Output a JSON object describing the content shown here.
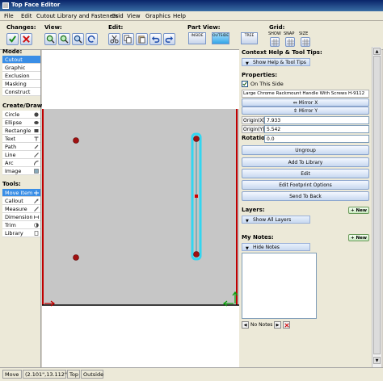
{
  "window": {
    "title": "Top Face Editor"
  },
  "menu": [
    "File",
    "Edit",
    "Cutout Library and Fasteners",
    "Grid",
    "View",
    "Graphics",
    "Help"
  ],
  "toolbar": {
    "changes_label": "Changes:",
    "view_label": "View:",
    "edit_label": "Edit:",
    "partview_label": "Part View:",
    "inside_label": "INSIDE",
    "outside_label": "OUTSIDE",
    "tree_label": "TREE",
    "grid_label": "Grid:",
    "show_label": "SHOW",
    "snap_label": "SNAP",
    "size_label": "SIZE"
  },
  "left": {
    "mode_head": "Mode:",
    "modes": [
      "Cutout",
      "Graphic",
      "Exclusion",
      "Masking",
      "Construct"
    ],
    "create_head": "Create/Draw:",
    "create": [
      "Circle",
      "Ellipse",
      "Rectangle",
      "Text",
      "Path",
      "Line",
      "Arc",
      "Image"
    ],
    "tools_head": "Tools:",
    "tools": [
      "Move Item",
      "Callout",
      "Measure",
      "Dimension",
      "Trim",
      "Library"
    ]
  },
  "right": {
    "help_head": "Context Help & Tool Tips:",
    "help_dd": "Show Help & Tool Tips",
    "props_head": "Properties:",
    "on_this_side": "On This Side",
    "part_name": "Large Chrome Rackmount Handle With Screws H-9112",
    "mirror_x": "Mirror X",
    "mirror_y": "Mirror Y",
    "origin_x_label": "Origin(X)",
    "origin_x": "7.933",
    "origin_y_label": "Origin(Y)",
    "origin_y": "5.542",
    "rotation_label": "Rotation",
    "rotation": "0.0",
    "actions": [
      "Ungroup",
      "Add To Library",
      "Edit",
      "Edit Footprint Options",
      "Send To Back"
    ],
    "layers_head": "Layers:",
    "new_label": "+ New",
    "layers_dd": "Show All Layers",
    "notes_head": "My Notes:",
    "notes_dd": "Hide Notes",
    "no_notes": "No Notes"
  },
  "status": {
    "mode": "Move",
    "coords": "(2.101\",13.112\")",
    "side": "Top",
    "view": "Outside"
  },
  "colors": {
    "accent": "#3a8ee6",
    "selection": "#33d6f0",
    "edge_red": "#c00000",
    "board": "#c6c6c6"
  }
}
